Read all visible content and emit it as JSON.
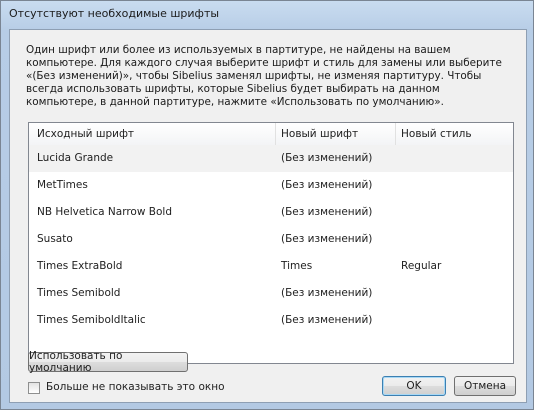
{
  "window": {
    "title": "Отсутствуют необходимые шрифты"
  },
  "message": "Один шрифт или более из используемых в партитуре, не найдены на вашем компьютере. Для каждого случая выберите шрифт и стиль для замены или выберите «(Без изменений)», чтобы Sibelius заменял шрифты, не изменяя партитуру. Чтобы всегда использовать шрифты, которые Sibelius будет выбирать на данном компьютере, в данной партитуре, нажмите «Использовать по умолчанию».",
  "table": {
    "headers": [
      "Исходный шрифт",
      "Новый шрифт",
      "Новый стиль"
    ],
    "rows": [
      {
        "source": "Lucida Grande",
        "new_font": "(Без изменений)",
        "new_style": ""
      },
      {
        "source": "MetTimes",
        "new_font": "(Без изменений)",
        "new_style": ""
      },
      {
        "source": "NB Helvetica Narrow Bold",
        "new_font": "(Без изменений)",
        "new_style": ""
      },
      {
        "source": "Susato",
        "new_font": "(Без изменений)",
        "new_style": ""
      },
      {
        "source": "Times ExtraBold",
        "new_font": "Times",
        "new_style": "Regular"
      },
      {
        "source": "Times Semibold",
        "new_font": "(Без изменений)",
        "new_style": ""
      },
      {
        "source": "Times SemiboldItalic",
        "new_font": "(Без изменений)",
        "new_style": ""
      }
    ],
    "selected_row": 0
  },
  "buttons": {
    "use_default": "Использовать по умолчанию",
    "ok": "OK",
    "cancel": "Отмена"
  },
  "checkbox": {
    "label": "Больше не показывать это окно",
    "checked": false
  }
}
